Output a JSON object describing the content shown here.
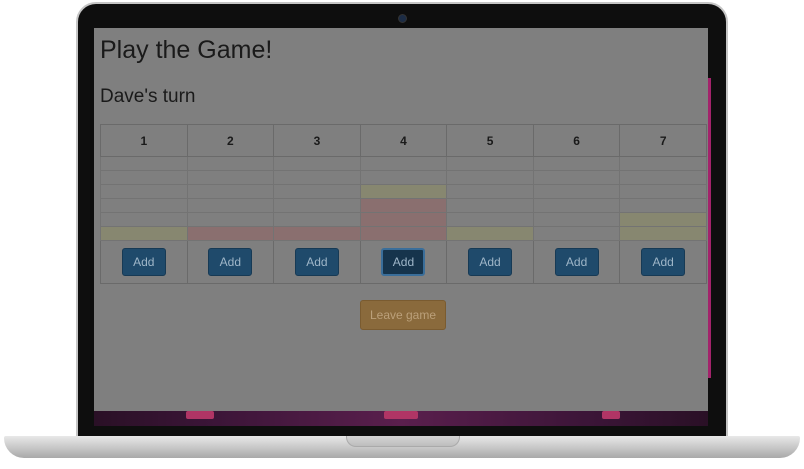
{
  "game": {
    "title": "Play the Game!",
    "turn": "Dave's turn",
    "columns": [
      "1",
      "2",
      "3",
      "4",
      "5",
      "6",
      "7"
    ],
    "add_label": "Add",
    "leave_label": "Leave game",
    "close_label": "×"
  },
  "board": [
    [
      "empty",
      "empty",
      "empty",
      "empty",
      "empty",
      "empty",
      "empty"
    ],
    [
      "empty",
      "empty",
      "empty",
      "empty",
      "empty",
      "empty",
      "empty"
    ],
    [
      "empty",
      "empty",
      "empty",
      "yellow",
      "empty",
      "empty",
      "empty"
    ],
    [
      "empty",
      "empty",
      "empty",
      "red",
      "empty",
      "empty",
      "empty"
    ],
    [
      "empty",
      "empty",
      "empty",
      "red",
      "empty",
      "empty",
      "yellow"
    ],
    [
      "yellow",
      "red",
      "red",
      "red",
      "yellow",
      "empty",
      "yellow"
    ]
  ],
  "active_add_column": 4,
  "colors": {
    "yellow_piece": "#878770",
    "red_piece": "#8a6f6f",
    "add_button": "#1f4a6b",
    "leave_button": "#8a6a3c",
    "overlay": "#7f7f7f"
  }
}
